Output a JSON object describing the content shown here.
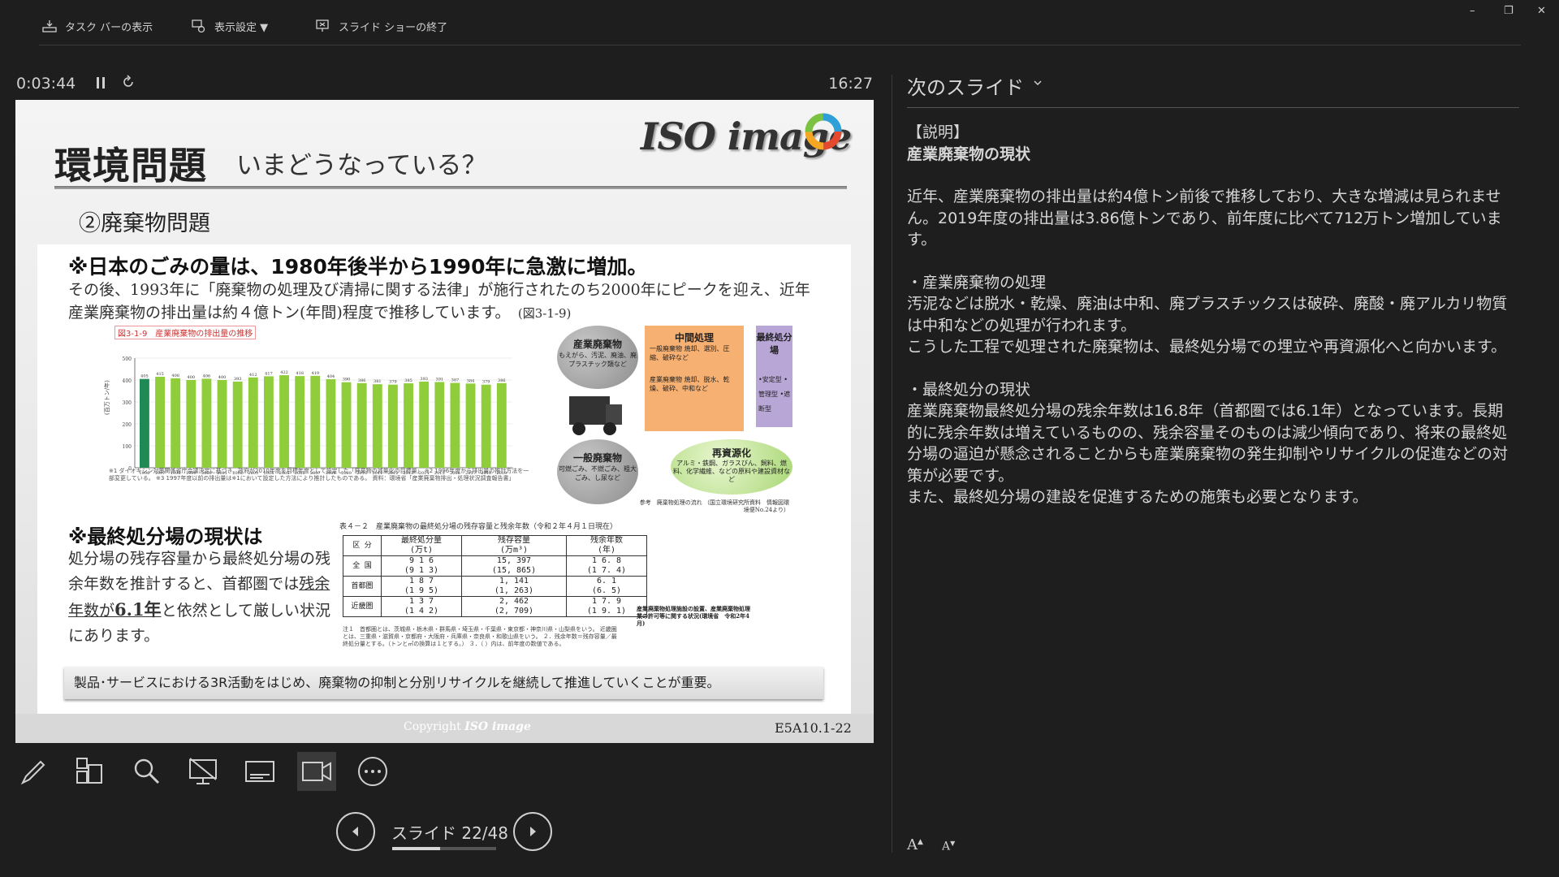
{
  "toolbar": {
    "taskbar_label": "タスク バーの表示",
    "display_settings_label": "表示設定 ▼",
    "end_show_label": "スライド ショーの終了"
  },
  "window": {
    "minimize": "–",
    "restore": "❐",
    "close": "✕"
  },
  "presenter": {
    "elapsed": "0:03:44",
    "clock": "16:27",
    "slide_counter": "スライド 22/48",
    "progress_fraction": 0.458
  },
  "slide": {
    "title": "環境問題",
    "subtitle": "いまどうなっている？",
    "logo_text": "ISO image",
    "section": "②廃棄物問題",
    "heading1": "※日本のごみの量は、1980年後半から1990年に急激に増加。",
    "para1": "その後、1993年に「廃棄物の処理及び清掃に関する法律」が施行されたのち2000年にピークを迎え、近年　産業廃棄物の排出量は約４億トン(年間)程度で推移しています。",
    "para1_ref": "(図3-1-9)",
    "chart_caption": "図3-1-9　産業廃棄物の排出量の推移",
    "chart_notes": "※1 ダイオキシン対策関係省庁会議決定に基づき、政府が2010年度を目標年度として設定した「廃棄物の減量化の目標量」 ※2 1996年度から排出量の推計方法を一部変更している。 ※3 1997年度以前の排出量は※1において設定した方法により推計したものである。 資料：環境省「産業廃棄物排出・処理状況調査報告書」",
    "flow": {
      "industrial": "産業廃棄物",
      "industrial_sub": "もえがら、汚泥、廃油、廃プラスチック類など",
      "general": "一般廃棄物",
      "general_sub": "可燃ごみ、不燃ごみ、粗大ごみ、し尿など",
      "middle": "中間処理",
      "middle_sub1": "一般廃棄物 焼却、選別、圧縮、破砕など",
      "middle_sub2": "産業廃棄物 焼却、脱水、乾燥、破砕、中和など",
      "final": "最終処分場",
      "final_sub": "•安定型 •管理型 •遮断型",
      "recycle": "再資源化",
      "recycle_sub": "アルミ・鉄鋼、ガラスびん、飼料、燃料、化学繊維、などの原料や建設資材など",
      "ref": "参考　廃棄物処理の流れ （国立環境研究所資料　情報図環境便No.24より）"
    },
    "heading2": "※最終処分場の現状は",
    "para2_a": "処分場の残存容量から最終処分場の残余年数を推計すると、首都圏では",
    "para2_u": "残余年数が",
    "para2_b": "6.1年",
    "para2_c": "と依然として厳しい状況にあります。",
    "table_title": "表４－２　産業廃棄物の最終処分場の残存容量と残余年数（令和２年４月１日現在）",
    "table_notes": "注１　首都圏とは、茨城県・栃木県・群馬県・埼玉県・千葉県・東京都・神奈川県・山梨県をいう。 近畿圏とは、三重県・滋賀県・京都府・大阪府・兵庫県・奈良県・和歌山県をいう。 ２．残余年数＝残存容量／最終処分量とする。（トンと㎥の換算は１とする。） ３．（ ）内は、前年度の数値である。",
    "table_side": "産業廃棄物処理施設の設置、産業廃棄物処理業の許可等に関する状況(環境省　令和2年4月)",
    "banner": "製品･サービスにおける3R活動をはじめ、廃棄物の抑制と分別リサイクルを継続して推進していくことが重要。",
    "copyright": "Copyright",
    "copyright_logo": "ISO image",
    "code": "E5A10.1-22"
  },
  "table": {
    "headers": [
      "区 分",
      "最終処分量\n(万t)",
      "残存容量\n(万m³)",
      "残余年数\n(年)"
    ],
    "rows": [
      [
        "全 国",
        "9 1 6\n(9 1 3)",
        "15, 397\n(15, 865)",
        "1 6. 8\n(1 7. 4)"
      ],
      [
        "首都圏",
        "1 8 7\n(1 9 5)",
        "1, 141\n(1, 263)",
        "6. 1\n(6. 5)"
      ],
      [
        "近畿圏",
        "1 3 7\n(1 4 2)",
        "2, 462\n(2, 709)",
        "1 7. 9\n(1 9. 1)"
      ]
    ]
  },
  "chart_data": {
    "type": "bar",
    "title": "産業廃棄物の排出量の推移",
    "ylabel": "(百万トン/年)",
    "yunit": "百万トン",
    "ylim": [
      0,
      500
    ],
    "yticks": [
      0,
      100,
      200,
      300,
      400,
      500
    ],
    "categories": [
      "1996",
      "1997",
      "1998",
      "1999",
      "2000",
      "2001",
      "2002",
      "2003",
      "2004",
      "2005",
      "2006",
      "2007",
      "2008",
      "2009",
      "2010",
      "2011",
      "2012",
      "2013",
      "2014",
      "2015",
      "2016",
      "2017",
      "2018",
      "2019"
    ],
    "values": [
      405,
      415,
      408,
      400,
      406,
      400,
      393,
      412,
      417,
      422,
      418,
      419,
      404,
      390,
      386,
      381,
      379,
      385,
      393,
      391,
      387,
      384,
      379,
      386
    ],
    "highlight_first": true,
    "colors": {
      "first": "#1f8a55",
      "rest": "#8fce3a"
    }
  },
  "notes": {
    "next_label": "次のスライド",
    "lines": [
      "【説明】",
      "産業廃棄物の現状",
      "",
      "近年、産業廃棄物の排出量は約4億トン前後で推移しており、大きな増減は見られません。2019年度の排出量は3.86億トンであり、前年度に比べて712万トン増加しています。",
      "",
      "・産業廃棄物の処理",
      "汚泥などは脱水・乾燥、廃油は中和、廃プラスチックスは破砕、廃酸・廃アルカリ物質は中和などの処理が行われます。",
      "こうした工程で処理された廃棄物は、最終処分場での埋立や再資源化へと向かいます。",
      "",
      "・最終処分の現状",
      "産業廃棄物最終処分場の残余年数は16.8年（首都圏では6.1年）となっています。長期的に残余年数は増えているものの、残余容量そのものは減少傾向であり、将来の最終処分場の逼迫が懸念されることからも産業廃棄物の発生抑制やリサイクルの促進などの対策が必要です。",
      "また、最終処分場の建設を促進するための施策も必要となります。"
    ],
    "increase_font": "A",
    "decrease_font": "A"
  }
}
